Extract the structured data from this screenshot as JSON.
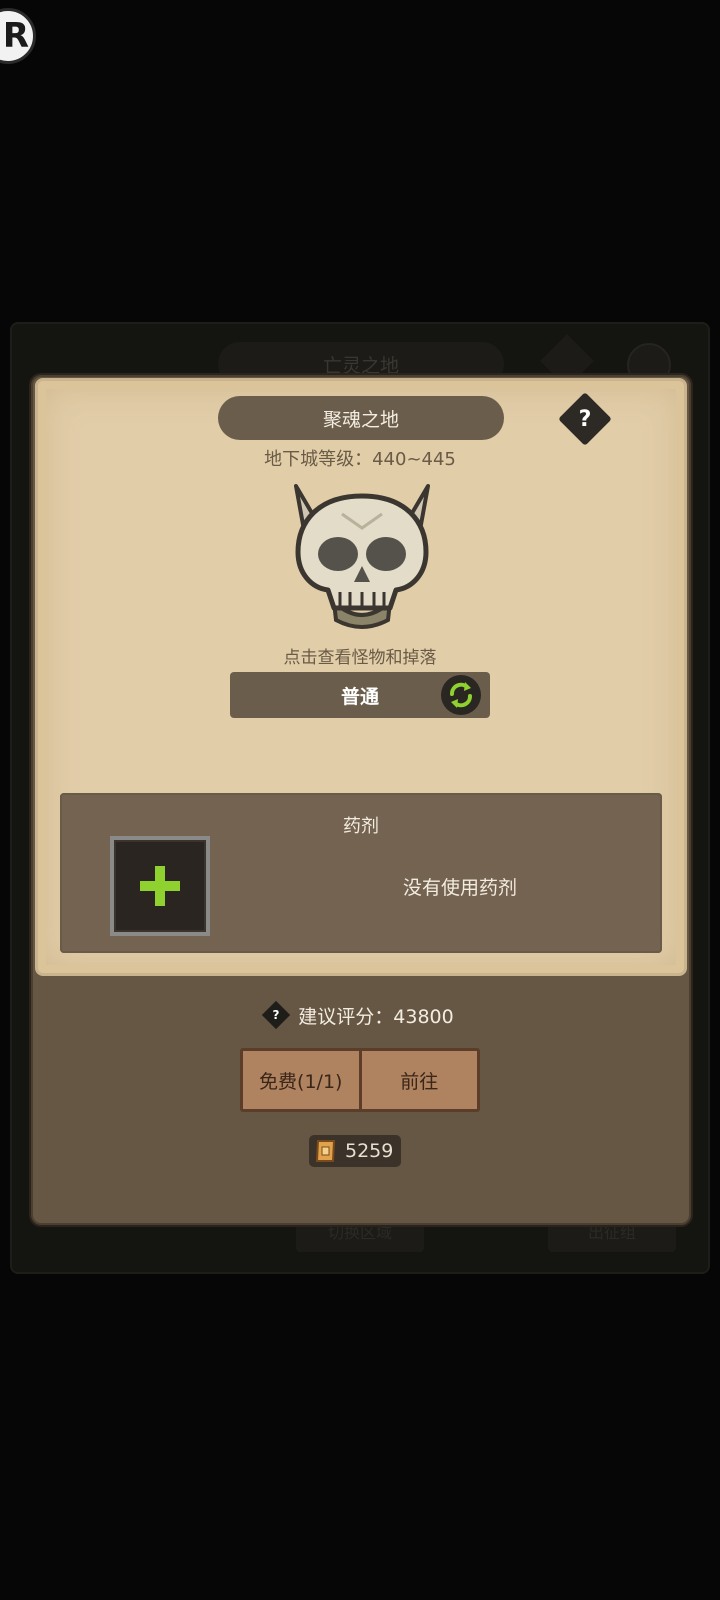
{
  "overlay": {
    "badge_letter": "R"
  },
  "background": {
    "title": "亡灵之地",
    "btn_left": "切换区域",
    "btn_right": "出征组"
  },
  "dialog": {
    "title": "聚魂之地",
    "help_label": "?",
    "dungeon_level": "地下城等级：440~445",
    "monster_icon": "horned-skull-icon",
    "monster_hint": "点击查看怪物和掉落",
    "difficulty": "普通",
    "potion": {
      "title": "药剂",
      "status": "没有使用药剂"
    },
    "score_help": "?",
    "recommended_score": "建议评分：43800",
    "buttons": {
      "free": "免费(1/1)",
      "go": "前往"
    },
    "currency": {
      "icon": "scroll-ticket-icon",
      "amount": "5259"
    }
  },
  "colors": {
    "parchment": "#e1cda8",
    "dialog_bg": "#655744",
    "pill": "#6a5d4c",
    "accent_green": "#8fd12e",
    "button_wood": "#b08360"
  }
}
